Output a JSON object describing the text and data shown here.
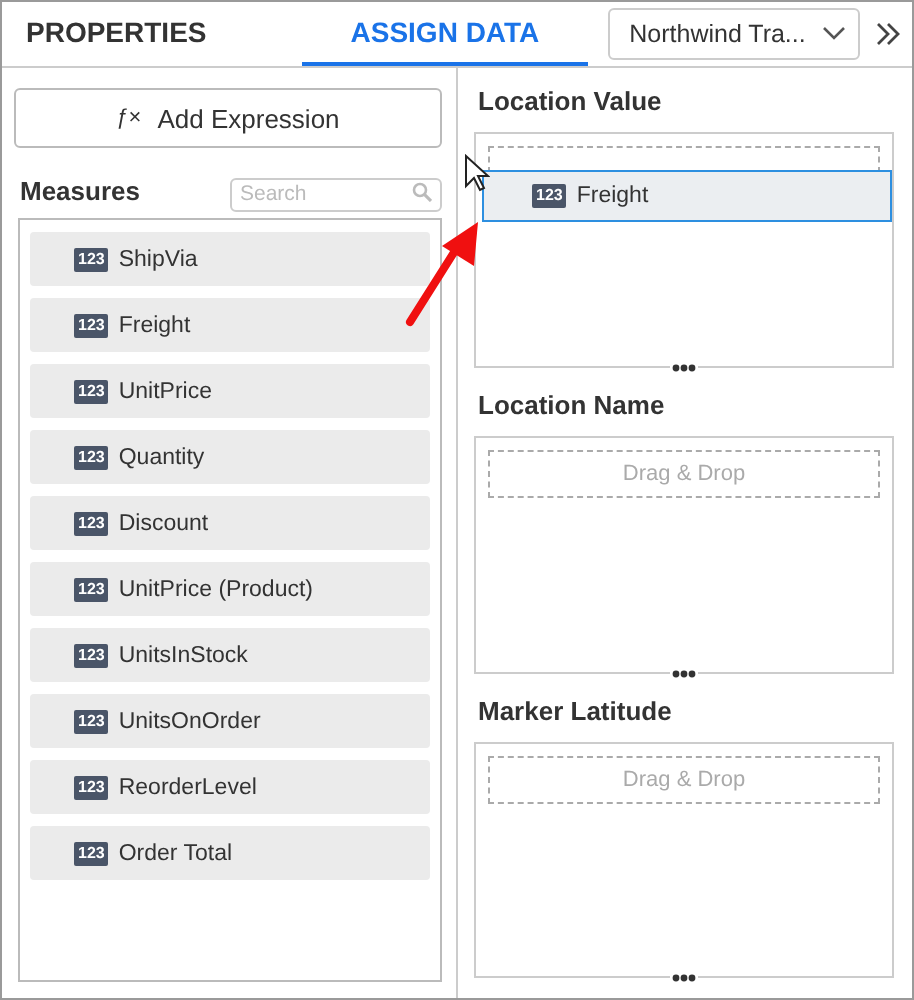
{
  "tabs": [
    {
      "label": "PROPERTIES",
      "selected": false
    },
    {
      "label": "ASSIGN DATA",
      "selected": true
    }
  ],
  "datasource": {
    "value": "Northwind Tra..."
  },
  "add_expression": {
    "icon": "ƒ×",
    "label": "Add Expression"
  },
  "measures": {
    "title": "Measures",
    "search": {
      "placeholder": "Search"
    },
    "items": [
      {
        "badge": "123",
        "label": "ShipVia"
      },
      {
        "badge": "123",
        "label": "Freight"
      },
      {
        "badge": "123",
        "label": "UnitPrice"
      },
      {
        "badge": "123",
        "label": "Quantity"
      },
      {
        "badge": "123",
        "label": "Discount"
      },
      {
        "badge": "123",
        "label": "UnitPrice (Product)"
      },
      {
        "badge": "123",
        "label": "UnitsInStock"
      },
      {
        "badge": "123",
        "label": "UnitsOnOrder"
      },
      {
        "badge": "123",
        "label": "ReorderLevel"
      },
      {
        "badge": "123",
        "label": "Order Total"
      }
    ]
  },
  "slots": [
    {
      "title": "Location Value"
    },
    {
      "title": "Location Name",
      "placeholder": "Drag & Drop"
    },
    {
      "title": "Marker Latitude",
      "placeholder": "Drag & Drop"
    }
  ],
  "drag_item": {
    "badge": "123",
    "label": "Freight"
  }
}
